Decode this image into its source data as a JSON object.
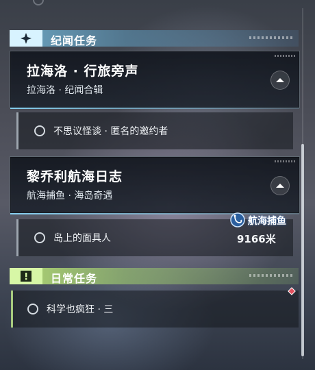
{
  "top_faded": {
    "label": "……"
  },
  "categories": [
    {
      "title": "纪闻任务",
      "icon": "sparkle-icon"
    },
    {
      "title": "日常任务",
      "icon": "exclamation-icon"
    }
  ],
  "quests": [
    {
      "name": "拉海洛 · 行旅旁声",
      "subtitle": "拉海洛 · 纪闻合辑",
      "tasks": [
        "不思议怪谈 · 匿名的邀约者"
      ]
    },
    {
      "name": "黎乔利航海日志",
      "subtitle": "航海捕鱼 · 海岛奇遇",
      "tasks": [
        "岛上的面具人"
      ],
      "tracker": {
        "activity": "航海捕鱼",
        "distance": "9166米",
        "icon": "fishing-icon"
      }
    }
  ],
  "daily": {
    "tasks": [
      "科学也疯狂 · 三"
    ]
  },
  "colors": {
    "accent_blue": "#8cdcff",
    "accent_green": "#bde58a",
    "alert_red": "#e0505e"
  }
}
